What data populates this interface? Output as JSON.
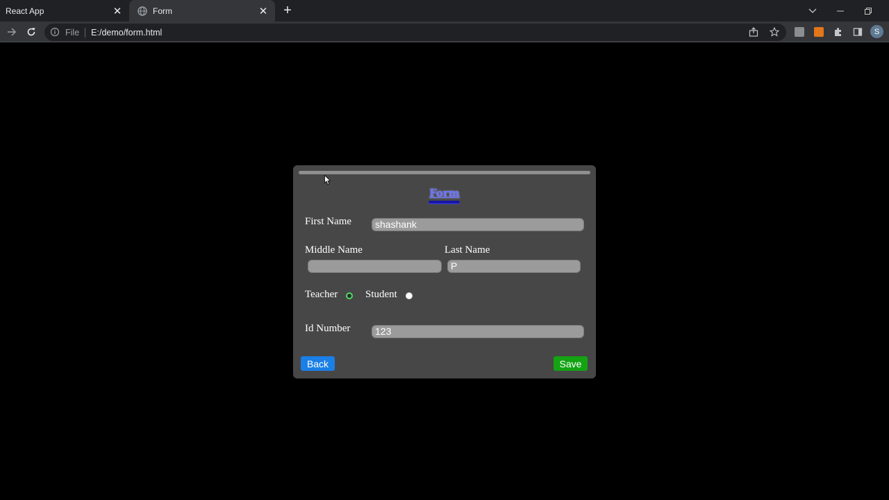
{
  "browser": {
    "tabs": [
      {
        "title": "React App",
        "active": false
      },
      {
        "title": "Form",
        "active": true
      }
    ],
    "address": {
      "scheme_label": "File",
      "url": "E:/demo/form.html"
    },
    "profile_initial": "S"
  },
  "form": {
    "title": "Form",
    "fields": {
      "first_name": {
        "label": "First Name",
        "value": "shashank"
      },
      "middle_name": {
        "label": "Middle Name",
        "value": ""
      },
      "last_name": {
        "label": "Last Name",
        "value": "P"
      },
      "id_number": {
        "label": "Id Number",
        "value": "123"
      }
    },
    "role": {
      "options": [
        {
          "label": "Teacher",
          "selected": true
        },
        {
          "label": "Student",
          "selected": false
        }
      ]
    },
    "buttons": {
      "back": "Back",
      "save": "Save"
    }
  },
  "colors": {
    "back_button": "#1a7fe6",
    "save_button": "#13a313",
    "title": "#6b74ff",
    "card": "#474747"
  }
}
